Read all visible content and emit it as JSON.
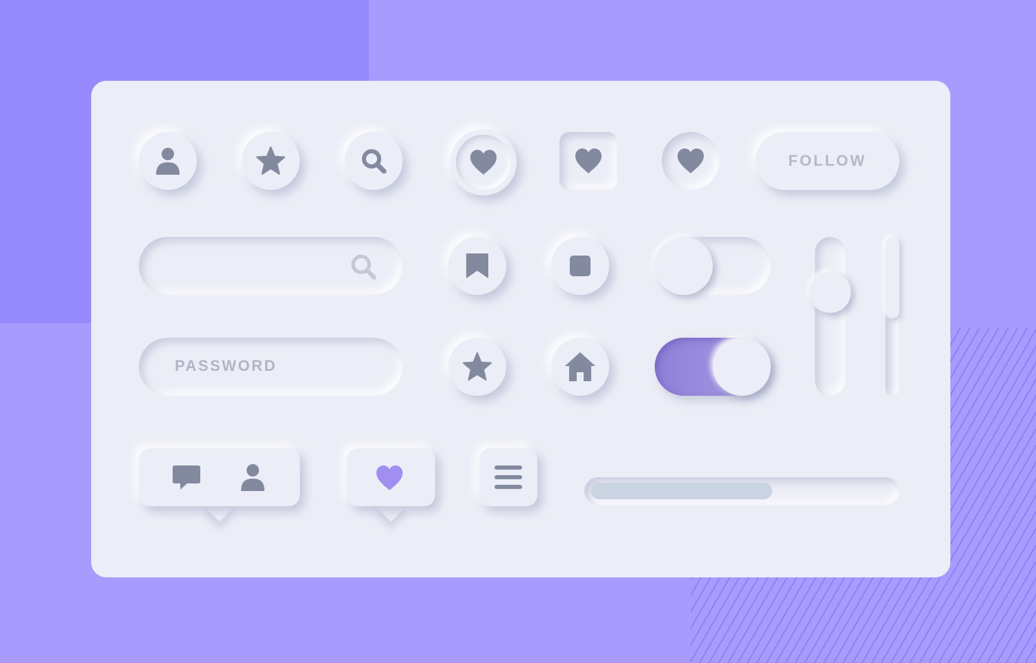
{
  "colors": {
    "background": "#a89bfd",
    "background_block": "#978afd",
    "card": "#eceef7",
    "icon": "#838a9f",
    "icon_light": "#c4c9d6",
    "accent": "#a08ef0",
    "progress_fill": "#c9d3e2"
  },
  "top_row": {
    "user_icon": "user-icon",
    "star_icon": "star-icon",
    "search_icon": "search-icon",
    "heart_icon": "heart-icon",
    "follow_label": "FOLLOW"
  },
  "search_field": {
    "value": "",
    "icon": "search-icon"
  },
  "password_field": {
    "placeholder": "PASSWORD"
  },
  "toggles": [
    {
      "name": "toggle-off",
      "state": "off"
    },
    {
      "name": "toggle-on",
      "state": "on"
    }
  ],
  "vertical_slider": {
    "level": 0.2
  },
  "thin_slider": {
    "level": 0.5
  },
  "speech_bubbles": {
    "comment_icon": "comment-icon",
    "user_icon": "user-icon",
    "heart_icon": "heart-icon"
  },
  "menu_icon": "menu-icon",
  "progress": {
    "value": 0.6
  }
}
